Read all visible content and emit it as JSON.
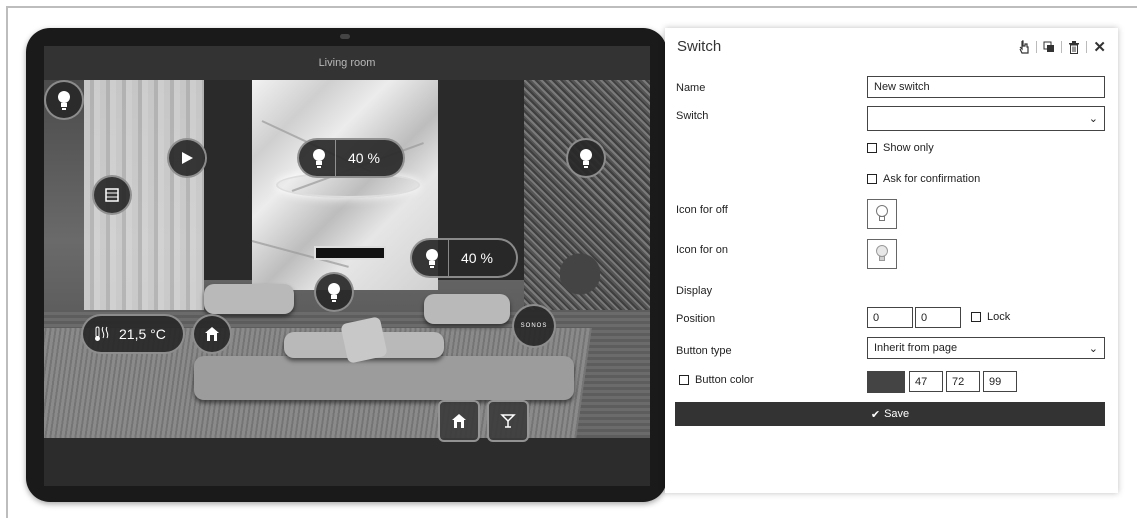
{
  "tablet": {
    "room_title": "Living room",
    "controls": {
      "dimmer_center_value": "40 %",
      "dimmer_right_value": "40 %",
      "thermostat_value": "21,5 °C",
      "sonos_label": "SONOS"
    }
  },
  "panel": {
    "title": "Switch",
    "fields": {
      "name_label": "Name",
      "name_value": "New switch",
      "switch_label": "Switch",
      "switch_value": "",
      "show_only_label": "Show only",
      "ask_confirmation_label": "Ask for confirmation",
      "icon_off_label": "Icon for off",
      "icon_on_label": "Icon for on",
      "display_label": "Display",
      "position_label": "Position",
      "position_x": "0",
      "position_y": "0",
      "lock_label": "Lock",
      "button_type_label": "Button type",
      "button_type_value": "Inherit from page",
      "button_color_label": "Button color",
      "color_r": "47",
      "color_g": "72",
      "color_b": "99"
    },
    "save_label": "Save"
  },
  "colors": {
    "accent": "#333333",
    "button_color_swatch": "#444444"
  },
  "icons": [
    "lightbulb-icon",
    "play-icon",
    "blind-icon",
    "thermometer-icon",
    "house-icon",
    "cocktail-icon",
    "pointer-icon",
    "copy-icon",
    "trash-icon",
    "close-icon",
    "checkmark-icon",
    "chevron-down-icon"
  ]
}
